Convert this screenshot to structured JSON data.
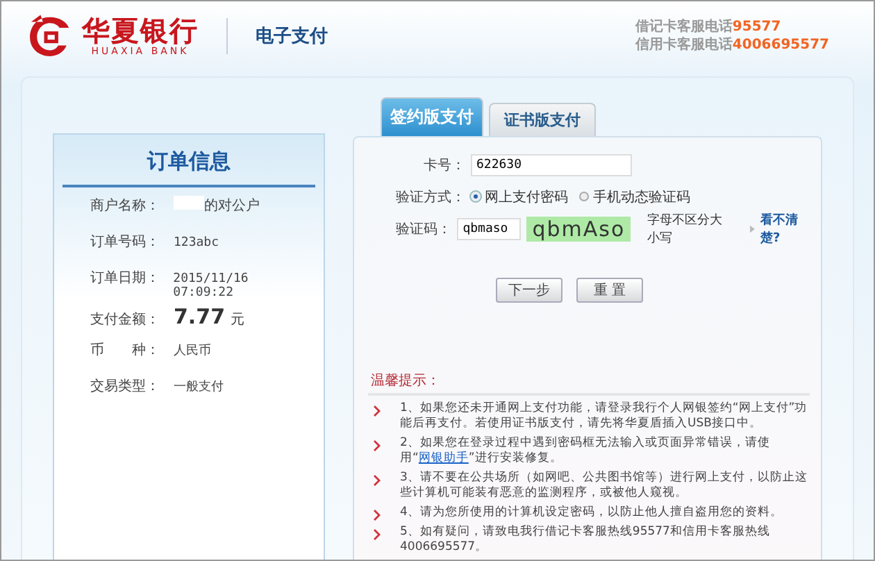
{
  "header": {
    "bank_name": "华夏银行",
    "bank_name_en": "HUAXIA BANK",
    "service": "电子支付",
    "hotlines": [
      {
        "label": "借记卡客服电话",
        "number": "95577"
      },
      {
        "label": "信用卡客服电话",
        "number": "4006695577"
      }
    ]
  },
  "order": {
    "title": "订单信息",
    "rows": [
      {
        "kind": "redacted",
        "label": "商户名称：",
        "value": "的对公户"
      },
      {
        "kind": "text",
        "label": "订单号码：",
        "value": "123abc"
      },
      {
        "kind": "text",
        "label": "订单日期：",
        "value": "2015/11/16 07:09:22"
      },
      {
        "kind": "amount",
        "label": "支付金额：",
        "value": "7.77",
        "unit": "元"
      },
      {
        "kind": "text",
        "label": "币　　种：",
        "value": "人民币"
      },
      {
        "kind": "text",
        "label": "交易类型：",
        "value": "一般支付"
      }
    ]
  },
  "tabs": [
    {
      "label": "签约版支付",
      "selected": true
    },
    {
      "label": "证书版支付",
      "selected": false
    }
  ],
  "form": {
    "card_label": "卡号：",
    "card_value": "622630",
    "method_label": "验证方式：",
    "methods": [
      {
        "label": "网上支付密码",
        "selected": true
      },
      {
        "label": "手机动态验证码",
        "selected": false
      }
    ],
    "code_label": "验证码：",
    "code_value": "qbmaso",
    "captcha_text": "qbmAso",
    "case_hint": "字母不区分大小写",
    "refresh_link": "看不清楚?",
    "buttons": [
      "下一步",
      "重 置"
    ]
  },
  "tips": {
    "title": "温馨提示：",
    "items": [
      {
        "kind": "plain",
        "text": "1、如果您还未开通网上支付功能，请登录我行个人网银签约“网上支付”功能后再支付。若使用证书版支付，请先将华夏盾插入USB接口中。"
      },
      {
        "kind": "link",
        "before": "2、如果您在登录过程中遇到密码框无法输入或页面异常错误，请使用“",
        "link": "网银助手",
        "after": "”进行安装修复。"
      },
      {
        "kind": "plain",
        "text": "3、请不要在公共场所（如网吧、公共图书馆等）进行网上支付，以防止这些计算机可能装有恶意的监测程序，或被他人窥视。"
      },
      {
        "kind": "plain",
        "text": "4、请为您所使用的计算机设定密码，以防止他人擅自盗用您的资料。"
      },
      {
        "kind": "plain",
        "text": "5、如有疑问，请致电我行借记卡客服热线95577和信用卡客服热线4006695577。"
      }
    ]
  }
}
